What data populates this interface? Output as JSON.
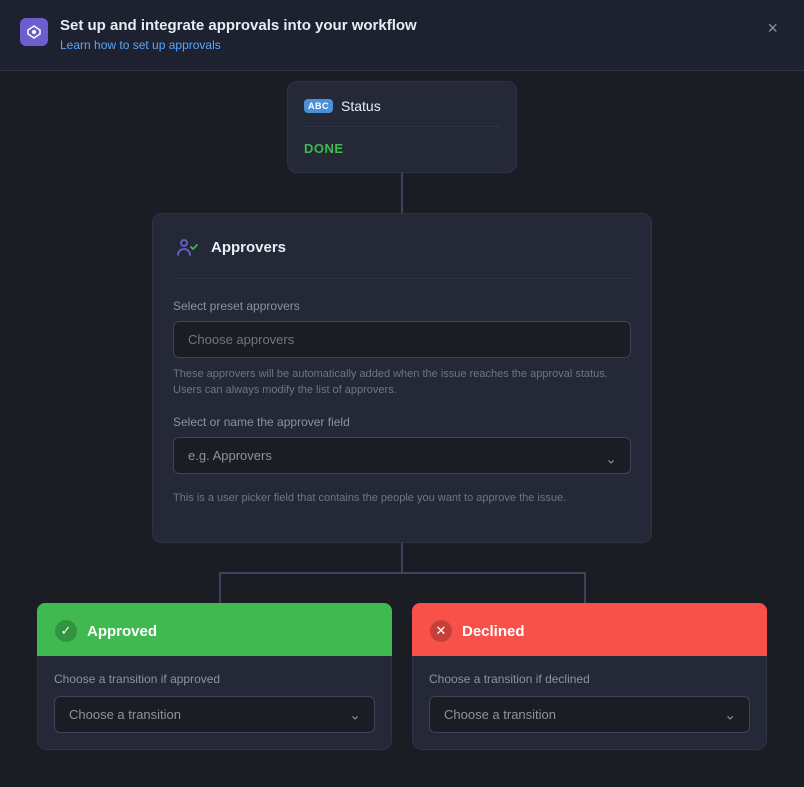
{
  "header": {
    "title": "Set up and integrate approvals into your workflow",
    "link_text": "Learn how to set up approvals",
    "close_label": "×"
  },
  "status_card": {
    "icon_text": "ABC",
    "title": "Status",
    "done_label": "DONE"
  },
  "approvers": {
    "title": "Approvers",
    "preset_label": "Select preset approvers",
    "preset_placeholder": "Choose approvers",
    "preset_hint": "These approvers will be automatically added when the issue reaches the approval status. Users can always modify the list of approvers.",
    "field_label": "Select or name the approver field",
    "field_placeholder": "e.g. Approvers",
    "field_hint": "This is a user picker field that contains the people you want to approve the issue."
  },
  "approved": {
    "label": "Approved",
    "transition_label": "Choose a transition if approved",
    "transition_placeholder": "Choose a transition"
  },
  "declined": {
    "label": "Declined",
    "transition_label": "Choose a transition if declined",
    "transition_placeholder": "Choose a transition"
  }
}
